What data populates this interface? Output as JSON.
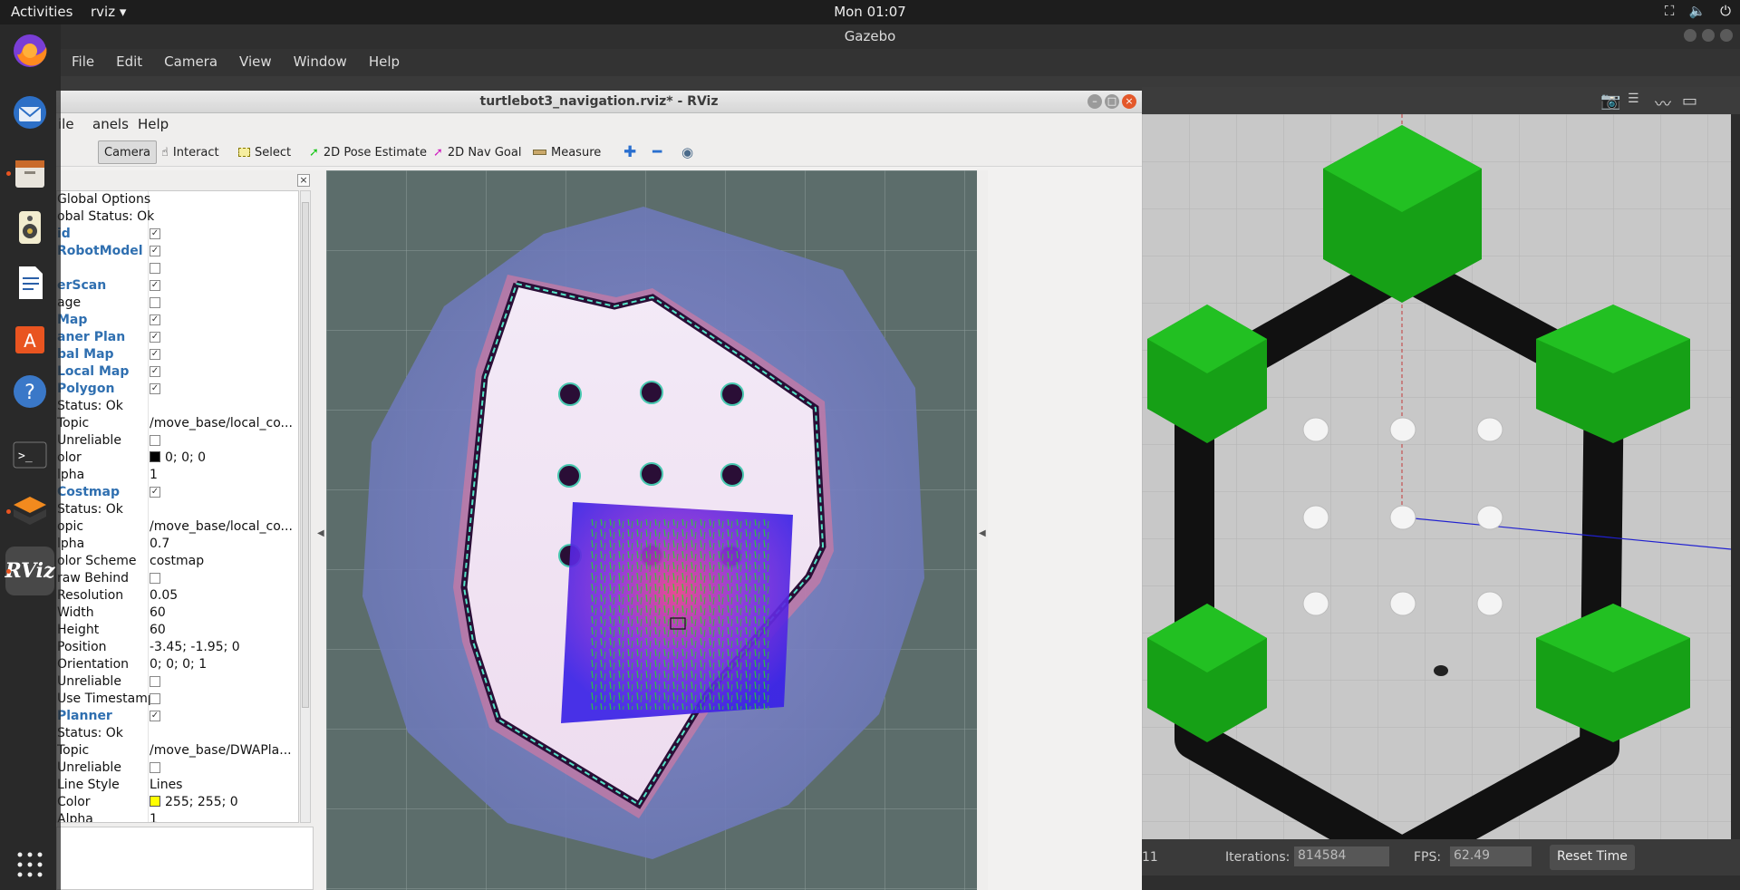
{
  "topbar": {
    "activities": "Activities",
    "app_name": "rviz ▾",
    "clock": "Mon 01:07"
  },
  "dock": {
    "items": [
      "Firefox",
      "Thunderbird",
      "Files",
      "Rhythmbox",
      "LibreOffice Writer",
      "Ubuntu Software",
      "Help",
      "Terminal",
      "Gazebo",
      "RViz",
      "Show Applications"
    ],
    "rviz_label": "RViz"
  },
  "gazebo": {
    "title": "Gazebo",
    "menu": [
      "File",
      "Edit",
      "Camera",
      "View",
      "Window",
      "Help"
    ],
    "bottom": {
      "sim_fragment": "11",
      "iterations_label": "Iterations:",
      "iterations_value": "814584",
      "fps_label": "FPS:",
      "fps_value": "62.49",
      "reset_label": "Reset Time"
    }
  },
  "rviz": {
    "title": "turtlebot3_navigation.rviz* - RViz",
    "menu": [
      "ile",
      "anels",
      "Help"
    ],
    "toolbar": {
      "camera": "Camera",
      "interact": "Interact",
      "select": "Select",
      "pose_estimate": "2D Pose Estimate",
      "nav_goal": "2D Nav Goal",
      "measure": "Measure"
    },
    "displays_rows": [
      {
        "key": "Global Options",
        "value": "",
        "cb": "",
        "blue": false,
        "indent": 22
      },
      {
        "key": "obal Status: Ok",
        "value": "",
        "cb": "",
        "blue": false,
        "indent": 22
      },
      {
        "key": "id",
        "value": "",
        "cb": "✓",
        "blue": true,
        "indent": 22
      },
      {
        "key": "RobotModel",
        "value": "",
        "cb": "✓",
        "blue": true,
        "indent": 22
      },
      {
        "key": "",
        "value": "",
        "cb": " ",
        "blue": false,
        "indent": 22
      },
      {
        "key": "erScan",
        "value": "",
        "cb": "✓",
        "blue": true,
        "indent": 22
      },
      {
        "key": "age",
        "value": "",
        "cb": " ",
        "blue": false,
        "indent": 22
      },
      {
        "key": "Map",
        "value": "",
        "cb": "✓",
        "blue": true,
        "indent": 22
      },
      {
        "key": "aner Plan",
        "value": "",
        "cb": "✓",
        "blue": true,
        "indent": 22
      },
      {
        "key": "bal Map",
        "value": "",
        "cb": "✓",
        "blue": true,
        "indent": 22
      },
      {
        "key": "Local Map",
        "value": "",
        "cb": "✓",
        "blue": true,
        "indent": 22
      },
      {
        "key": "Polygon",
        "value": "",
        "cb": "✓",
        "blue": true,
        "indent": 36
      },
      {
        "key": "Status: Ok",
        "value": "",
        "cb": "",
        "blue": false,
        "indent": 52
      },
      {
        "key": "Topic",
        "value": "/move_base/local_co...",
        "cb": "",
        "blue": false,
        "indent": 52
      },
      {
        "key": "Unreliable",
        "value": "",
        "cb": " ",
        "blue": false,
        "indent": 52
      },
      {
        "key": "olor",
        "value": "0; 0; 0",
        "cb": "",
        "blue": false,
        "indent": 52,
        "swatch": "#000000"
      },
      {
        "key": "lpha",
        "value": "1",
        "cb": "",
        "blue": false,
        "indent": 52
      },
      {
        "key": "Costmap",
        "value": "",
        "cb": "✓",
        "blue": true,
        "indent": 36
      },
      {
        "key": "Status: Ok",
        "value": "",
        "cb": "",
        "blue": false,
        "indent": 52
      },
      {
        "key": "opic",
        "value": "/move_base/local_co...",
        "cb": "",
        "blue": false,
        "indent": 52
      },
      {
        "key": "lpha",
        "value": "0.7",
        "cb": "",
        "blue": false,
        "indent": 52
      },
      {
        "key": "olor Scheme",
        "value": "costmap",
        "cb": "",
        "blue": false,
        "indent": 52
      },
      {
        "key": "raw Behind",
        "value": "",
        "cb": " ",
        "blue": false,
        "indent": 52
      },
      {
        "key": "Resolution",
        "value": "0.05",
        "cb": "",
        "blue": false,
        "indent": 52
      },
      {
        "key": "Width",
        "value": "60",
        "cb": "",
        "blue": false,
        "indent": 52
      },
      {
        "key": "Height",
        "value": "60",
        "cb": "",
        "blue": false,
        "indent": 52
      },
      {
        "key": "Position",
        "value": "-3.45; -1.95; 0",
        "cb": "",
        "blue": false,
        "indent": 52
      },
      {
        "key": "Orientation",
        "value": "0; 0; 0; 1",
        "cb": "",
        "blue": false,
        "indent": 52
      },
      {
        "key": "Unreliable",
        "value": "",
        "cb": " ",
        "blue": false,
        "indent": 52
      },
      {
        "key": "Use Timestamp",
        "value": "",
        "cb": " ",
        "blue": false,
        "indent": 52
      },
      {
        "key": "Planner",
        "value": "",
        "cb": "✓",
        "blue": true,
        "indent": 36
      },
      {
        "key": "Status: Ok",
        "value": "",
        "cb": "",
        "blue": false,
        "indent": 52
      },
      {
        "key": "Topic",
        "value": "/move_base/DWAPla...",
        "cb": "",
        "blue": false,
        "indent": 52
      },
      {
        "key": "Unreliable",
        "value": "",
        "cb": " ",
        "blue": false,
        "indent": 52
      },
      {
        "key": "Line Style",
        "value": "Lines",
        "cb": "",
        "blue": false,
        "indent": 52
      },
      {
        "key": "Color",
        "value": "255; 255; 0",
        "cb": "",
        "blue": false,
        "indent": 52,
        "swatch": "#ffff00"
      },
      {
        "key": "Alpha",
        "value": "1",
        "cb": "",
        "blue": false,
        "indent": 52
      }
    ]
  },
  "colors": {
    "accent": "#e95420",
    "rviz_label_blue": "#2f6fb0",
    "gazebo_green": "#1aa51a",
    "viewport_bg": "#5c6d6b"
  }
}
